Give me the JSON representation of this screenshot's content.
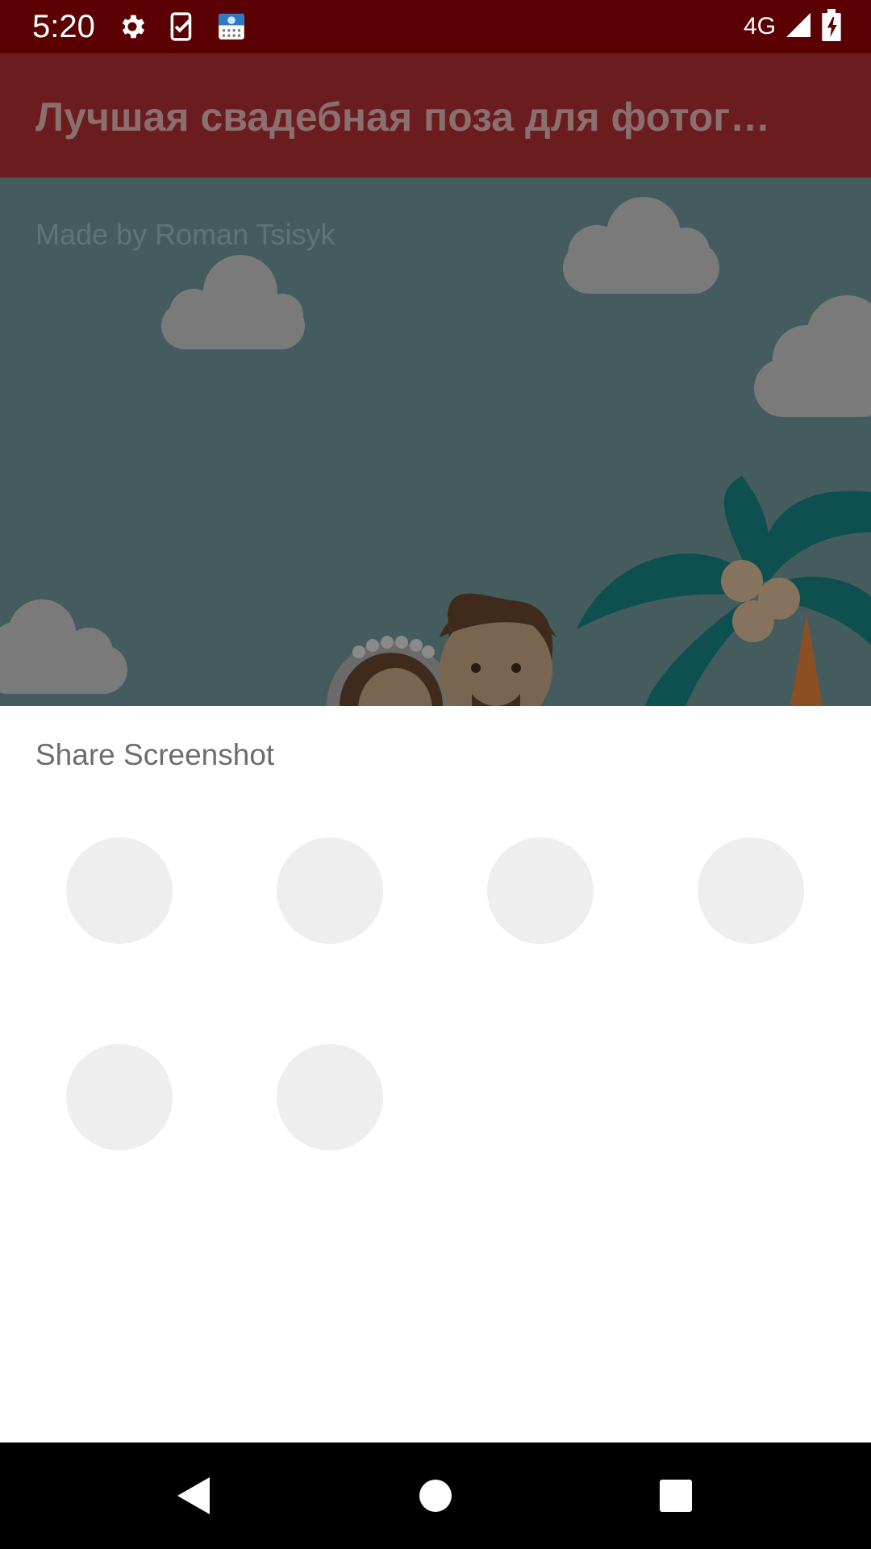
{
  "status_bar": {
    "time": "5:20",
    "network": "4G",
    "icons": [
      "settings-icon",
      "task-check-icon",
      "test-app-icon",
      "signal-icon",
      "battery-charging-icon"
    ]
  },
  "app_bar": {
    "title": "Лучшая свадебная поза для фотог…",
    "background": "#6b1c1e"
  },
  "scene": {
    "credit": "Made by Roman Tsisyk",
    "background": "#455c5e"
  },
  "share_sheet": {
    "title": "Share Screenshot",
    "targets": [
      "",
      "",
      "",
      "",
      "",
      ""
    ],
    "placeholder_color": "#eeeeee"
  },
  "nav_bar": {
    "buttons": [
      "back-icon",
      "home-icon",
      "recents-icon"
    ]
  }
}
